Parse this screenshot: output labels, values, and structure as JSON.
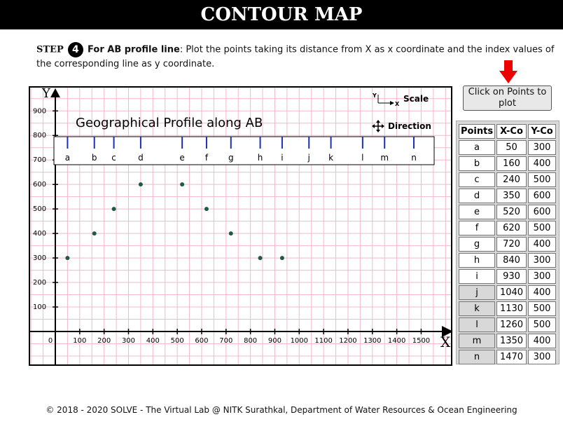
{
  "header": {
    "title": "CONTOUR MAP"
  },
  "instruction": {
    "step_word": "STEP",
    "step_number": "4",
    "heading": "For AB profile line",
    "text": ": Plot the points taking its distance from X as x coordinate and the index values of the corresponding line as y coordinate."
  },
  "plot": {
    "profile_title": "Geographical Profile along AB",
    "scale_label": "Scale",
    "direction_label": "Direction",
    "axis_x_letter": "X",
    "axis_y_letter": "Y",
    "mini_axis_y": "Y",
    "mini_axis_x": "X",
    "colors": {
      "grid": "#f2b8cc",
      "point": "#1f5a48",
      "tick": "#1a2fc0"
    }
  },
  "chart_data": {
    "type": "scatter",
    "x_ticks": [
      0,
      100,
      200,
      300,
      400,
      500,
      600,
      700,
      800,
      900,
      1000,
      1100,
      1200,
      1300,
      1400,
      1500
    ],
    "y_ticks": [
      100,
      200,
      300,
      400,
      500,
      600,
      700,
      800,
      900
    ],
    "profile_labels": [
      {
        "label": "a",
        "x": 50
      },
      {
        "label": "b",
        "x": 160
      },
      {
        "label": "c",
        "x": 240
      },
      {
        "label": "d",
        "x": 350
      },
      {
        "label": "e",
        "x": 520
      },
      {
        "label": "f",
        "x": 620
      },
      {
        "label": "g",
        "x": 720
      },
      {
        "label": "h",
        "x": 840
      },
      {
        "label": "i",
        "x": 930
      },
      {
        "label": "j",
        "x": 1040
      },
      {
        "label": "k",
        "x": 1130
      },
      {
        "label": "l",
        "x": 1260
      },
      {
        "label": "m",
        "x": 1350
      },
      {
        "label": "n",
        "x": 1470
      }
    ],
    "plotted_points": [
      {
        "x": 50,
        "y": 300
      },
      {
        "x": 160,
        "y": 400
      },
      {
        "x": 240,
        "y": 500
      },
      {
        "x": 350,
        "y": 600
      },
      {
        "x": 520,
        "y": 600
      },
      {
        "x": 620,
        "y": 500
      },
      {
        "x": 720,
        "y": 400
      },
      {
        "x": 840,
        "y": 300
      },
      {
        "x": 930,
        "y": 300
      }
    ],
    "xlim": [
      0,
      1500
    ],
    "ylim": [
      0,
      900
    ],
    "grid": true
  },
  "side_panel": {
    "button_label": "Click on Points to plot",
    "table": {
      "headers": [
        "Points",
        "X-Co",
        "Y-Co"
      ],
      "rows": [
        {
          "p": "a",
          "x": "50",
          "y": "300",
          "plotted": true
        },
        {
          "p": "b",
          "x": "160",
          "y": "400",
          "plotted": true
        },
        {
          "p": "c",
          "x": "240",
          "y": "500",
          "plotted": true
        },
        {
          "p": "d",
          "x": "350",
          "y": "600",
          "plotted": true
        },
        {
          "p": "e",
          "x": "520",
          "y": "600",
          "plotted": true
        },
        {
          "p": "f",
          "x": "620",
          "y": "500",
          "plotted": true
        },
        {
          "p": "g",
          "x": "720",
          "y": "400",
          "plotted": true
        },
        {
          "p": "h",
          "x": "840",
          "y": "300",
          "plotted": true
        },
        {
          "p": "i",
          "x": "930",
          "y": "300",
          "plotted": true
        },
        {
          "p": "j",
          "x": "1040",
          "y": "400",
          "plotted": false
        },
        {
          "p": "k",
          "x": "1130",
          "y": "500",
          "plotted": false
        },
        {
          "p": "l",
          "x": "1260",
          "y": "500",
          "plotted": false
        },
        {
          "p": "m",
          "x": "1350",
          "y": "400",
          "plotted": false
        },
        {
          "p": "n",
          "x": "1470",
          "y": "300",
          "plotted": false
        }
      ]
    }
  },
  "footer": {
    "text": "© 2018 - 2020 SOLVE - The Virtual Lab @ NITK Surathkal, Department of Water Resources & Ocean Engineering"
  }
}
